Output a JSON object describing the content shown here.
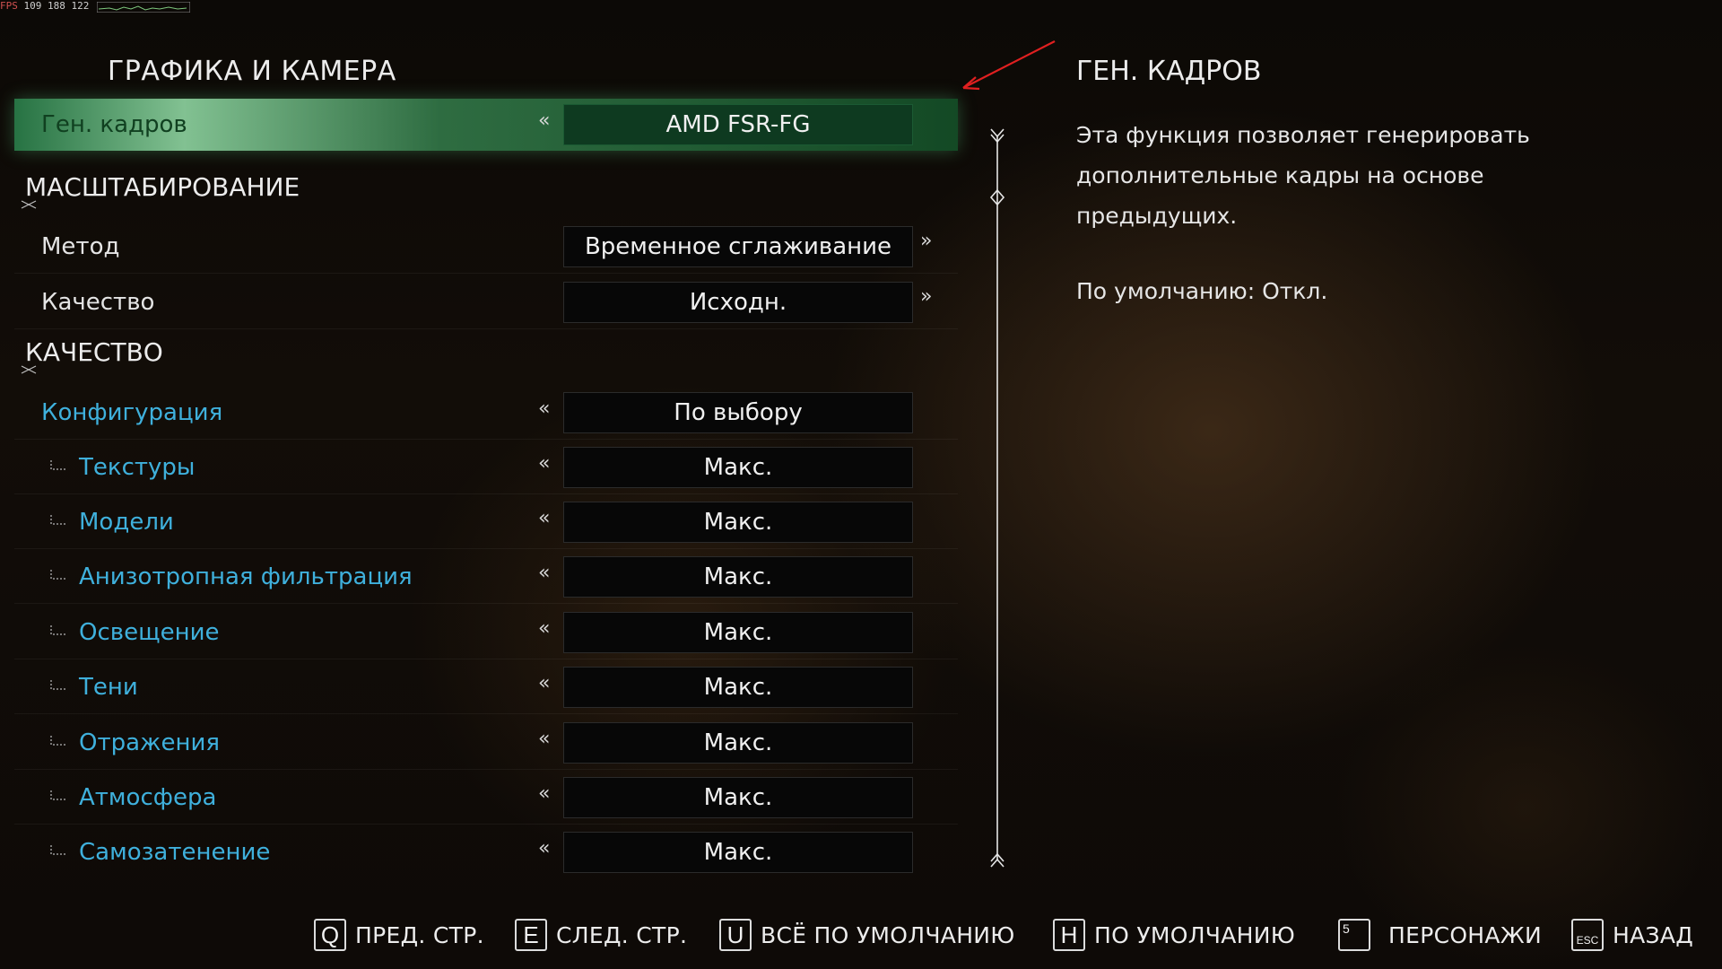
{
  "fps_overlay": {
    "label": "FPS",
    "values": "109 188 122"
  },
  "page": {
    "title": "ГРАФИКА И КАМЕРА"
  },
  "settings": {
    "frame_gen": {
      "label": "Ген. кадров",
      "value": "AMD FSR-FG"
    },
    "scaling_header": "МАСШТАБИРОВАНИЕ",
    "method": {
      "label": "Метод",
      "value": "Временное сглаживание"
    },
    "scaling_quality": {
      "label": "Качество",
      "value": "Исходн."
    },
    "quality_header": "КАЧЕСТВО",
    "config": {
      "label": "Конфигурация",
      "value": "По выбору"
    },
    "textures": {
      "label": "Текстуры",
      "value": "Макс."
    },
    "models": {
      "label": "Модели",
      "value": "Макс."
    },
    "aniso": {
      "label": "Анизотропная фильтрация",
      "value": "Макс."
    },
    "lighting": {
      "label": "Освещение",
      "value": "Макс."
    },
    "shadows": {
      "label": "Тени",
      "value": "Макс."
    },
    "reflections": {
      "label": "Отражения",
      "value": "Макс."
    },
    "atmosphere": {
      "label": "Атмосфера",
      "value": "Макс."
    },
    "self_shadow": {
      "label": "Самозатенение",
      "value": "Макс."
    }
  },
  "help": {
    "title": "ГЕН. КАДРОВ",
    "description": "Эта функция позволяет генерировать дополнительные кадры на основе предыдущих.",
    "default": "По умолчанию: Откл."
  },
  "footer": {
    "prev": {
      "key": "Q",
      "label": "ПРЕД. СТР."
    },
    "next": {
      "key": "E",
      "label": "СЛЕД. СТР."
    },
    "reset_all": {
      "key": "U",
      "label": "ВСЁ ПО УМОЛЧАНИЮ"
    },
    "reset": {
      "key": "H",
      "label": "ПО УМОЛЧАНИЮ"
    },
    "characters": {
      "key": "5",
      "label": "ПЕРСОНАЖИ"
    },
    "back": {
      "key": "ESC",
      "label": "НАЗАД"
    }
  },
  "colors": {
    "highlight": "#2f8a50",
    "sub_label": "#3fb0dc",
    "annotation": "#e02020"
  },
  "icons": [
    "arrow-left-double-icon",
    "arrow-right-double-icon",
    "tree-branch-icon",
    "scrollbar-ornament-icon",
    "red-annotation-arrow-icon"
  ]
}
